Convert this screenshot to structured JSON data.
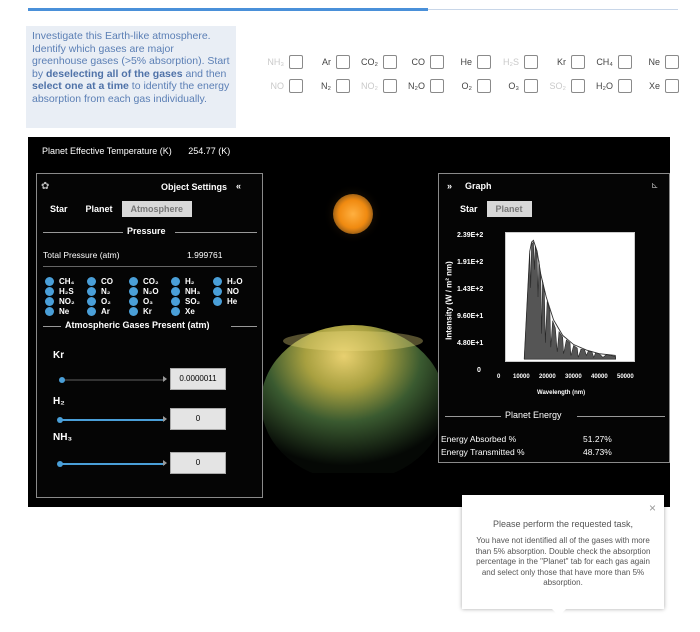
{
  "instructions": {
    "p1": "Investigate this Earth-like atmosphere. Identify which gases are major greenhouse gases (>5% absorption). Start by ",
    "bold1": "deselecting all of the gases",
    "p2": " and then ",
    "bold2": "select one at a time",
    "p3": " to identify the energy absorption from each gas individually."
  },
  "gas_checkboxes": {
    "row1": [
      {
        "label": "NH₃",
        "dim": true
      },
      {
        "label": "Ar",
        "dim": false
      },
      {
        "label": "CO₂",
        "dim": false
      },
      {
        "label": "CO",
        "dim": false
      },
      {
        "label": "He",
        "dim": false
      },
      {
        "label": "H₂S",
        "dim": true
      },
      {
        "label": "Kr",
        "dim": false
      },
      {
        "label": "CH₄",
        "dim": false
      },
      {
        "label": "Ne",
        "dim": false
      }
    ],
    "row2": [
      {
        "label": "NO",
        "dim": true
      },
      {
        "label": "N₂",
        "dim": false
      },
      {
        "label": "NO₂",
        "dim": true
      },
      {
        "label": "N₂O",
        "dim": false
      },
      {
        "label": "O₂",
        "dim": false
      },
      {
        "label": "O₃",
        "dim": false
      },
      {
        "label": "SO₂",
        "dim": true
      },
      {
        "label": "H₂O",
        "dim": false
      },
      {
        "label": "Xe",
        "dim": false
      }
    ]
  },
  "sim": {
    "temp_label": "Planet Effective Temperature (K)",
    "temp_value": "254.77 (K)",
    "settings_title": "Object Settings",
    "collapse": "«",
    "tabs": {
      "star": "Star",
      "planet": "Planet",
      "atmosphere": "Atmosphere"
    },
    "pressure_title": "Pressure",
    "total_pressure_label": "Total Pressure (atm)",
    "total_pressure_value": "1.999761",
    "gas_dots": [
      [
        "CH₄",
        "CO",
        "CO₂",
        "H₂",
        "H₂O"
      ],
      [
        "H₂S",
        "N₂",
        "N₂O",
        "NH₃",
        "NO"
      ],
      [
        "NO₂",
        "O₂",
        "O₃",
        "SO₂",
        "He"
      ],
      [
        "Ne",
        "Ar",
        "Kr",
        "Xe"
      ]
    ],
    "present_title": "Atmospheric Gases Present (atm)",
    "present": [
      {
        "name": "Kr",
        "value": "0.0000011"
      },
      {
        "name": "H₂",
        "value": "0"
      },
      {
        "name": "NH₃",
        "value": "0"
      }
    ]
  },
  "graph": {
    "expand": "»",
    "title": "Graph",
    "tabs": {
      "star": "Star",
      "planet": "Planet"
    },
    "ylabel": "Intensity (W / m² nm)",
    "xlabel": "Wavelength (nm)",
    "yticks": [
      "2.39E+2",
      "1.91E+2",
      "1.43E+2",
      "9.60E+1",
      "4.80E+1",
      "0"
    ],
    "xticks": [
      "0",
      "10000",
      "20000",
      "30000",
      "40000",
      "50000"
    ],
    "energy_title": "Planet Energy",
    "absorbed_label": "Energy Absorbed %",
    "absorbed_value": "51.27%",
    "transmitted_label": "Energy Transmitted %",
    "transmitted_value": "48.73%"
  },
  "dialog": {
    "close": "×",
    "title": "Please perform the requested task,",
    "body": "You have not identified all of the gases with more than 5% absorption. Double check the absorption percentage in the \"Planet\" tab for each gas again and select only those that have more than 5% absorption."
  }
}
